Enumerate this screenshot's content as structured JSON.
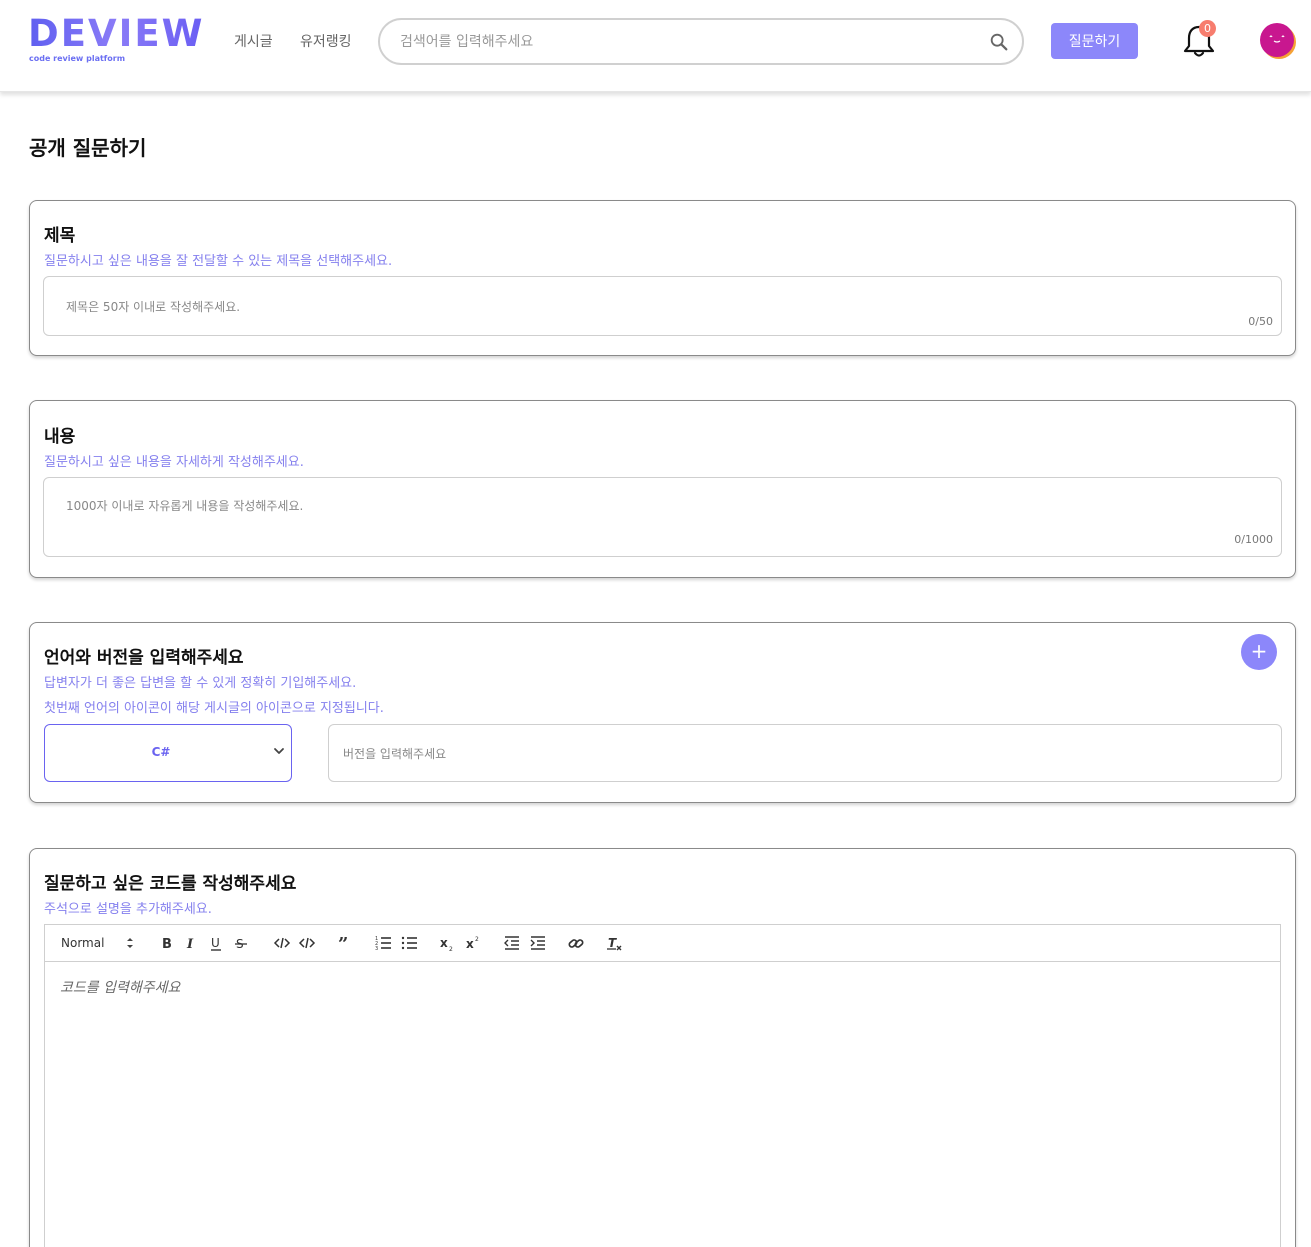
{
  "header": {
    "logo_text": "DEVIEW",
    "logo_sub": "code review platform",
    "nav": [
      "게시글",
      "유저랭킹"
    ],
    "search_placeholder": "검색어를 입력해주세요",
    "ask_button": "질문하기",
    "notification_count": "0"
  },
  "page": {
    "title": "공개 질문하기"
  },
  "title_section": {
    "heading": "제목",
    "desc": "질문하시고 싶은 내용을 잘 전달할 수 있는 제목을 선택해주세요.",
    "placeholder": "제목은 50자 이내로 작성해주세요.",
    "counter": "0/50"
  },
  "content_section": {
    "heading": "내용",
    "desc": "질문하시고 싶은 내용을 자세하게 작성해주세요.",
    "placeholder": "1000자 이내로 자유롭게 내용을 작성해주세요.",
    "counter": "0/1000"
  },
  "language_section": {
    "heading": "언어와 버전을 입력해주세요",
    "desc1": "답변자가 더 좋은 답변을 할 수 있게 정확히 기입해주세요.",
    "desc2": "첫번째 언어의 아이콘이 해당 게시글의 아이콘으로 지정됩니다.",
    "selected_language": "C#",
    "version_placeholder": "버전을 입력해주세요",
    "add_label": "+"
  },
  "code_section": {
    "heading": "질문하고 싶은 코드를 작성해주세요",
    "desc": "주석으로 설명을 추가해주세요.",
    "format_select": "Normal",
    "editor_placeholder": "코드를 입력해주세요"
  },
  "colors": {
    "accent": "#8c87fa",
    "desc_text": "#8580ee",
    "badge": "#f77d6e"
  }
}
